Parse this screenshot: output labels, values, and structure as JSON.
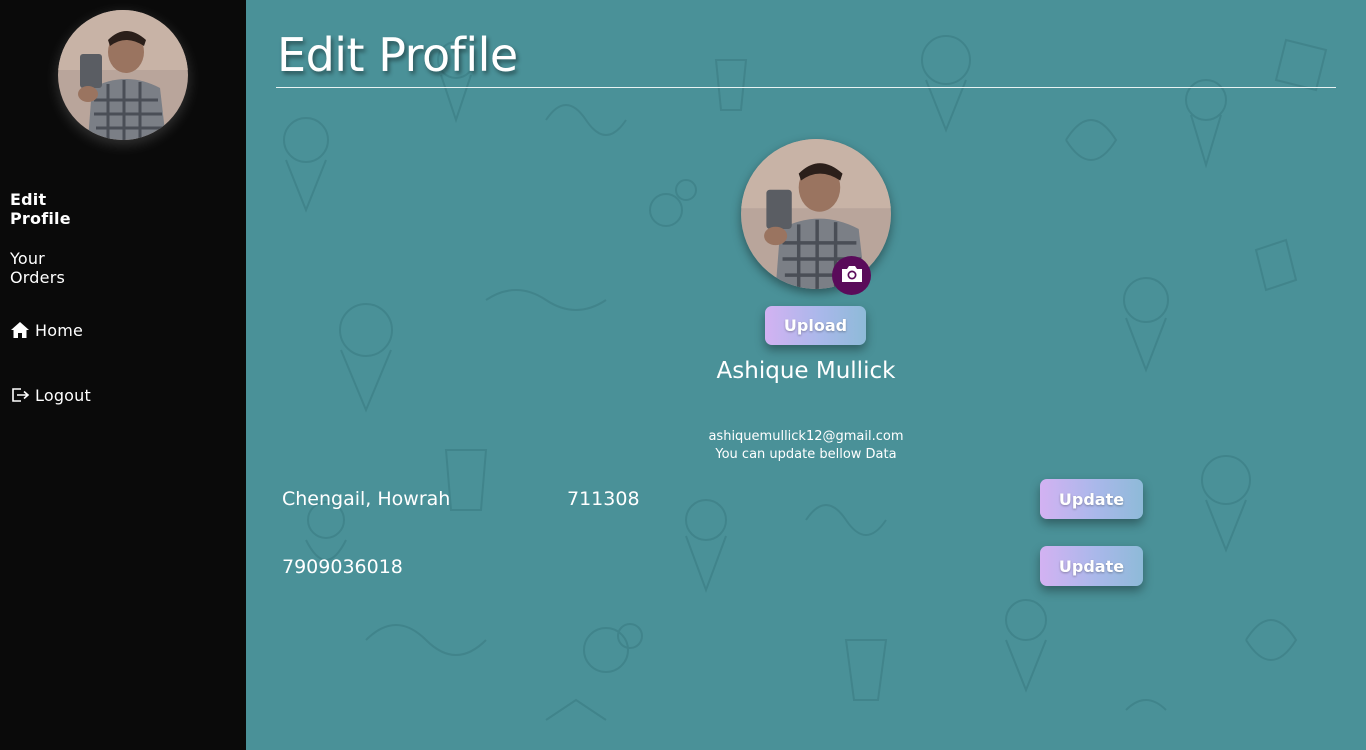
{
  "sidebar": {
    "items": [
      {
        "label": "Edit Profile"
      },
      {
        "label": "Your Orders"
      },
      {
        "label": "Home",
        "icon": "home-icon"
      },
      {
        "label": "Logout",
        "icon": "logout-icon"
      }
    ]
  },
  "main": {
    "title": "Edit Profile",
    "upload_label": "Upload",
    "name": "Ashique Mullick",
    "email": "ashiquemullick12@gmail.com",
    "hint": "You can update bellow Data",
    "address": "Chengail, Howrah",
    "pincode": "711308",
    "phone": "7909036018",
    "update_label": "Update"
  },
  "colors": {
    "sidebar_bg": "#0a0a0a",
    "main_bg": "#4a9198",
    "camera_bg": "#5a0b5a",
    "button_gradient_start": "#d3b2f2",
    "button_gradient_end": "#8ebad8"
  }
}
